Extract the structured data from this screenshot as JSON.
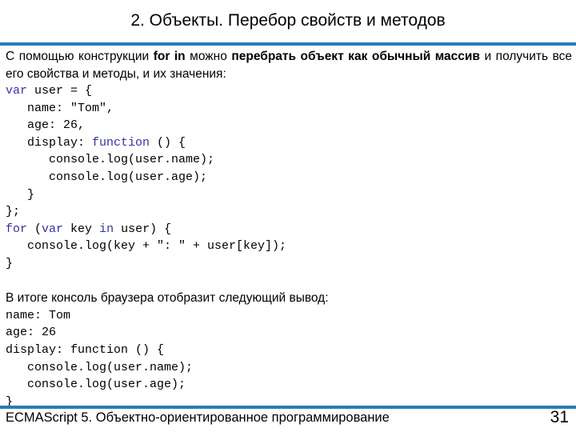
{
  "slide": {
    "title": "2. Объекты. Перебор свойств и методов",
    "intro": {
      "part1": "С помощью конструкции ",
      "bold1": "for in",
      "part2": " можно ",
      "bold2": "перебрать объект как обычный массив",
      "part3": " и получить все его свойства и методы, и их значения:"
    },
    "code": {
      "line1": {
        "kw": "var",
        "rest": " user = {"
      },
      "line2": "   name: \"Tom\",",
      "line3": "   age: 26,",
      "line4": {
        "pre": "   display: ",
        "kw": "function",
        "rest": " () {"
      },
      "line5": "      console.log(user.name);",
      "line6": "      console.log(user.age);",
      "line7": "   }",
      "line8": "};",
      "line9": {
        "kw1": "for",
        "mid1": " (",
        "kw2": "var",
        "mid2": " key ",
        "kw3": "in",
        "rest": " user) {"
      },
      "line10": "   console.log(key + \": \" + user[key]);",
      "line11": "}"
    },
    "result_text": "В итоге консоль браузера отобразит следующий вывод:",
    "output": [
      "name: Tom",
      "age: 26",
      "display: function () {",
      "   console.log(user.name);",
      "   console.log(user.age);",
      "}"
    ],
    "footer": "ECMAScript 5. Объектно-ориентированное программирование",
    "page_number": "31",
    "colors": {
      "accent_rule": "#2a7ab8",
      "keyword": "#3333a0"
    }
  }
}
